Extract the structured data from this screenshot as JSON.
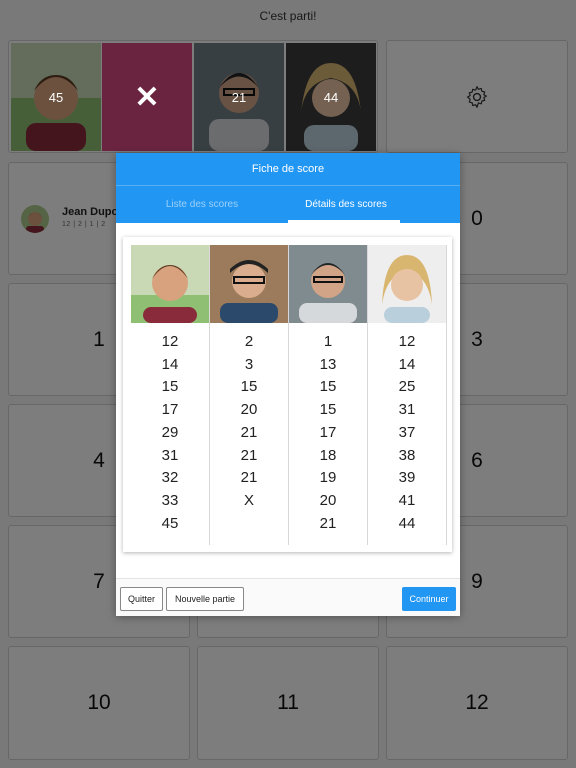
{
  "app": {
    "title": "C'est parti!"
  },
  "players_strip": [
    {
      "score": "45",
      "state": "selected"
    },
    {
      "score": "✕",
      "state": "crossed"
    },
    {
      "score": "21",
      "state": "normal"
    },
    {
      "score": "44",
      "state": "normal"
    }
  ],
  "current_player": {
    "name": "Jean Dupo",
    "scores": "12 | 2 | 1 | 2"
  },
  "grid": {
    "cells": [
      "0",
      "1",
      "3",
      "4",
      "6",
      "7",
      "9",
      "10",
      "11",
      "12"
    ]
  },
  "modal": {
    "title": "Fiche de score",
    "tabs": {
      "list": "Liste des scores",
      "details": "Détails des scores"
    },
    "columns": [
      {
        "scores": [
          "12",
          "14",
          "15",
          "17",
          "29",
          "31",
          "32",
          "33",
          "45"
        ]
      },
      {
        "scores": [
          "2",
          "3",
          "15",
          "20",
          "21",
          "21",
          "21",
          "X"
        ]
      },
      {
        "scores": [
          "1",
          "13",
          "15",
          "15",
          "17",
          "18",
          "19",
          "20",
          "21"
        ]
      },
      {
        "scores": [
          "12",
          "14",
          "25",
          "31",
          "37",
          "38",
          "39",
          "41",
          "44"
        ]
      }
    ],
    "buttons": {
      "quit": "Quitter",
      "new_game": "Nouvelle partie",
      "continue": "Continuer"
    }
  },
  "icons": {
    "settings": "gear-icon",
    "crossed": "close-icon"
  },
  "colors": {
    "primary": "#2196f3",
    "selected": "#e0297a",
    "crossed": "#d4497f"
  }
}
